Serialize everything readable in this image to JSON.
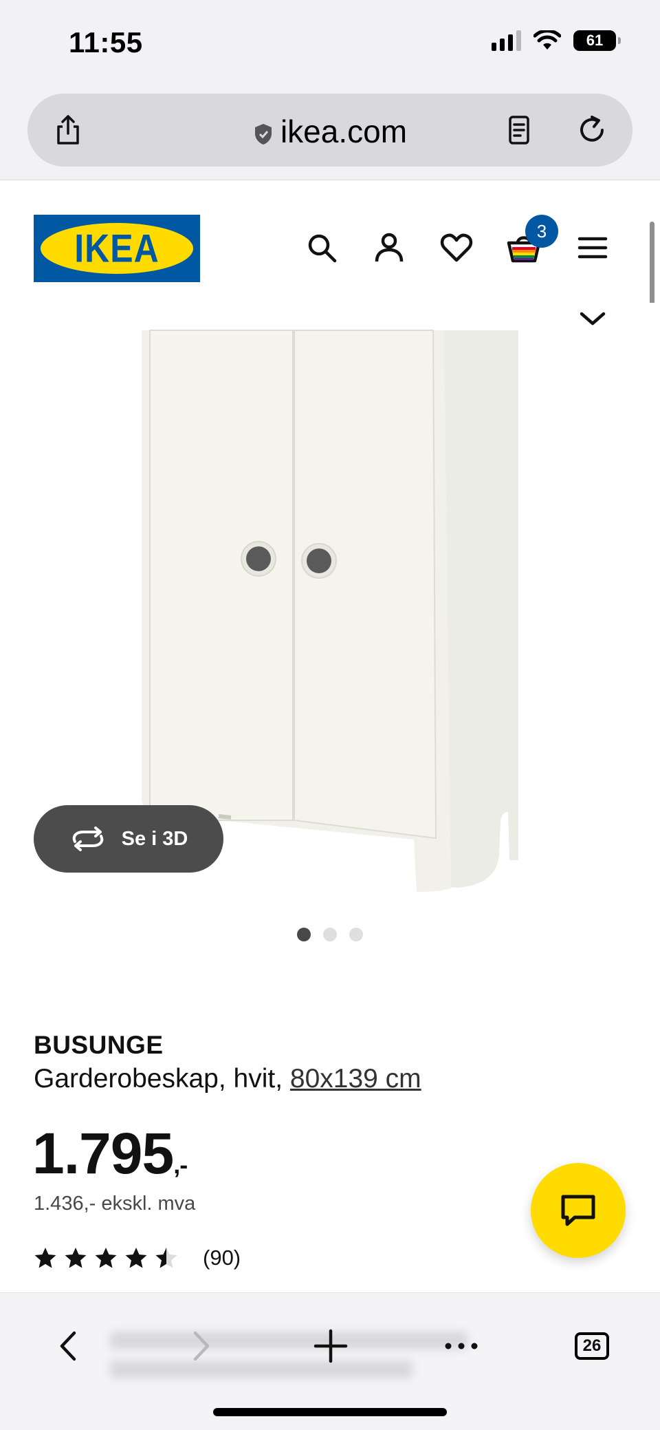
{
  "status_bar": {
    "time": "11:55",
    "battery": "61"
  },
  "browser": {
    "domain": "ikea.com",
    "tabs_count": "26"
  },
  "header": {
    "logo_text": "IKEA",
    "cart_count": "3"
  },
  "gallery": {
    "view_3d_label": "Se i 3D",
    "dots_total": 3,
    "active_dot": 1
  },
  "product": {
    "name": "BUSUNGE",
    "description": "Garderobeskap, hvit,",
    "size": "80x139 cm",
    "price": "1.795",
    "price_suffix": ",-",
    "price_ex_vat": "1.436,- ekskl. mva",
    "rating": 4.5,
    "rating_max": 5,
    "review_count": "(90)"
  },
  "colors": {
    "ikea_blue": "#0058a3",
    "ikea_yellow": "#ffdb00"
  }
}
